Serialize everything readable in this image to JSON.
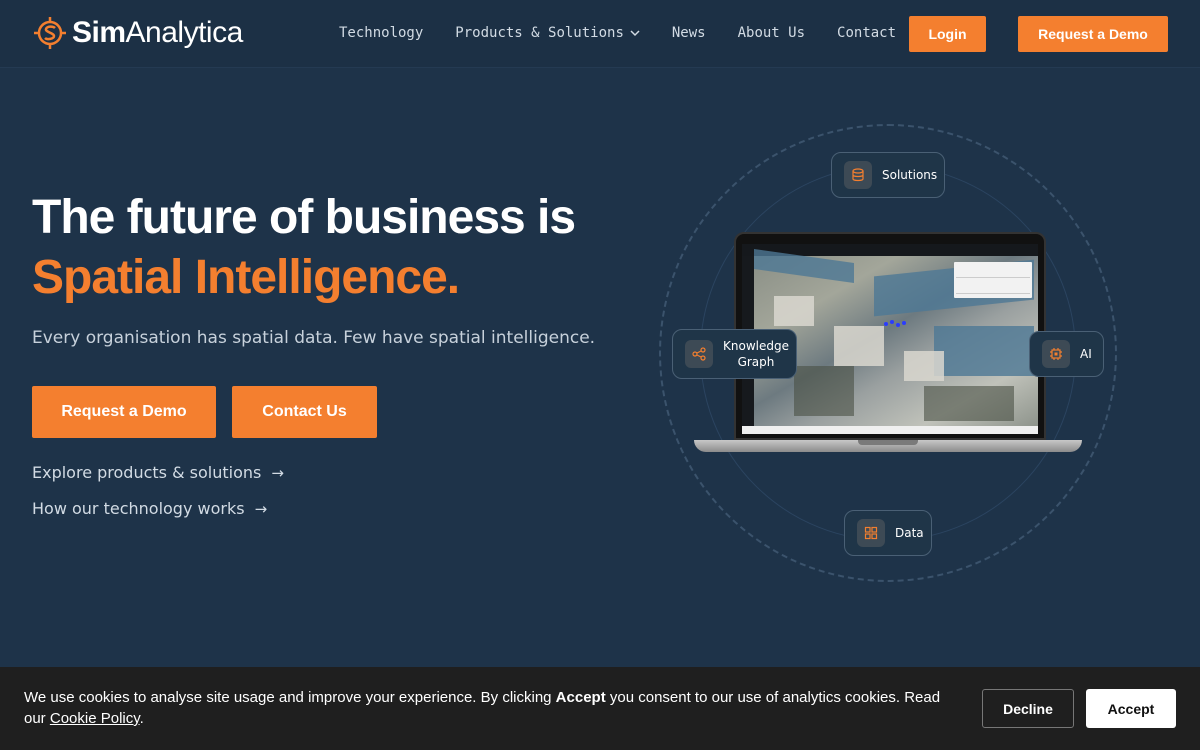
{
  "brand": {
    "name_bold": "Sim",
    "name_regular": "Analytica",
    "accent_color": "#f47f2f"
  },
  "nav": {
    "items": [
      {
        "label": "Technology"
      },
      {
        "label": "Products & Solutions",
        "has_dropdown": true
      },
      {
        "label": "News"
      },
      {
        "label": "About Us"
      },
      {
        "label": "Contact"
      }
    ],
    "login_label": "Login",
    "demo_label": "Request a Demo"
  },
  "hero": {
    "title_line1": "The future of business is",
    "title_line2": "Spatial Intelligence.",
    "subtitle": "Every organisation has spatial data. Few have spatial intelligence.",
    "primary_button": "Request a Demo",
    "secondary_button": "Contact Us",
    "links": [
      {
        "label": "Explore products & solutions",
        "arrow": "→"
      },
      {
        "label": "How our technology works",
        "arrow": "→"
      }
    ]
  },
  "illustration": {
    "chips": {
      "solutions": {
        "label": "Solutions",
        "icon": "database-icon"
      },
      "knowledge": {
        "label_line1": "Knowledge",
        "label_line2": "Graph",
        "icon": "share-icon"
      },
      "ai": {
        "label": "AI",
        "icon": "cpu-icon"
      },
      "data": {
        "label": "Data",
        "icon": "grid-icon"
      }
    }
  },
  "cookie": {
    "text_before": "We use cookies to analyse site usage and improve your experience. By clicking ",
    "text_bold": "Accept",
    "text_after": " you consent to our use of analytics cookies. Read our ",
    "policy_link": "Cookie Policy",
    "text_end": ".",
    "decline_label": "Decline",
    "accept_label": "Accept"
  }
}
